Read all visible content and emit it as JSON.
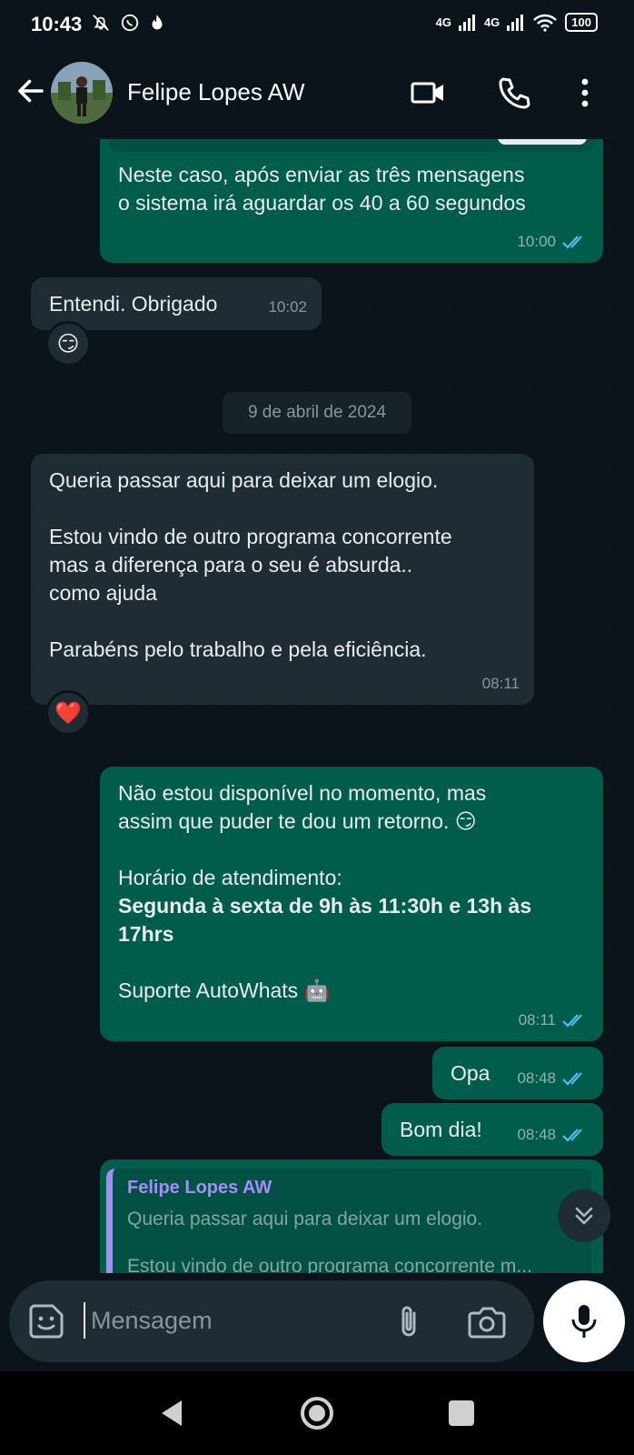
{
  "status_bar": {
    "time": "10:43",
    "network1": "4G",
    "network2": "4G",
    "battery": "100"
  },
  "header": {
    "contact_name": "Felipe Lopes AW"
  },
  "chat": {
    "msg1": {
      "line1": "Neste caso, após enviar as três mensagens",
      "line2": "o sistema irá aguardar os 40 a 60 segundos",
      "time": "10:00"
    },
    "msg2": {
      "text": "Entendi. Obrigado",
      "time": "10:02",
      "reaction": "😏"
    },
    "date_chip": "9 de abril de 2024",
    "msg3": {
      "line1": "Queria passar aqui para deixar um elogio.",
      "line2": "Estou vindo de outro programa concorrente",
      "line3": "mas a diferença para o seu é absurda..",
      "line4": "como ajuda",
      "line5": "Parabéns pelo trabalho e pela eficiência.",
      "time": "08:11",
      "reaction": "❤️"
    },
    "msg4": {
      "line1": "Não estou disponível no momento, mas",
      "line2": "assim que puder te dou um retorno. 😏",
      "line3": "Horário de atendimento:",
      "bold1": "Segunda à sexta de 9h às 11:30h e 13h às",
      "bold2": "17hrs",
      "line4": "Suporte AutoWhats 🤖",
      "time": "08:11"
    },
    "msg5": {
      "text": "Opa",
      "time": "08:48"
    },
    "msg6": {
      "text": "Bom dia!",
      "time": "08:48"
    },
    "quote": {
      "name": "Felipe Lopes AW",
      "line1": "Queria passar aqui para deixar um elogio.",
      "line2": "Estou vindo de outro programa concorrente m..."
    }
  },
  "input": {
    "placeholder": "Mensagem"
  },
  "colors": {
    "outgoing_bubble": "#005c4b",
    "incoming_bubble": "#202c33",
    "background": "#0b141a",
    "read_ticks": "#53bdeb"
  }
}
